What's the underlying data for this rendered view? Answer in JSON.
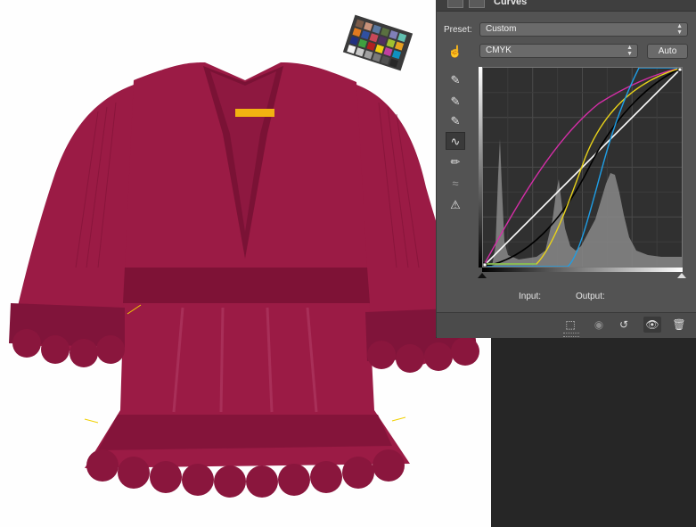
{
  "panel": {
    "title": "Curves",
    "preset_label": "Preset:",
    "preset_value": "Custom",
    "channel_value": "CMYK",
    "auto_label": "Auto",
    "input_label": "Input:",
    "output_label": "Output:"
  },
  "tools": [
    {
      "name": "on-image-adjust-icon",
      "glyph": "☝"
    },
    {
      "name": "sample-black-point-icon",
      "glyph": "✎"
    },
    {
      "name": "sample-gray-point-icon",
      "glyph": "✎"
    },
    {
      "name": "sample-white-point-icon",
      "glyph": "✎"
    },
    {
      "name": "edit-points-curve-icon",
      "glyph": "∿"
    },
    {
      "name": "draw-pencil-icon",
      "glyph": "✏"
    },
    {
      "name": "smooth-curve-icon",
      "glyph": "≈"
    },
    {
      "name": "clipping-warning-icon",
      "glyph": "⚠"
    }
  ],
  "colors": {
    "garment": "#9b1b45",
    "panel": "#535353",
    "cyan_curve": "#1e9ee6",
    "magenta_curve": "#d62ea8",
    "yellow_curve": "#e8d21a",
    "black_curve": "#000000"
  },
  "footer_icons": [
    "clip-to-layer-icon",
    "view-previous-state-icon",
    "reset-icon",
    "toggle-visibility-icon",
    "delete-icon"
  ]
}
